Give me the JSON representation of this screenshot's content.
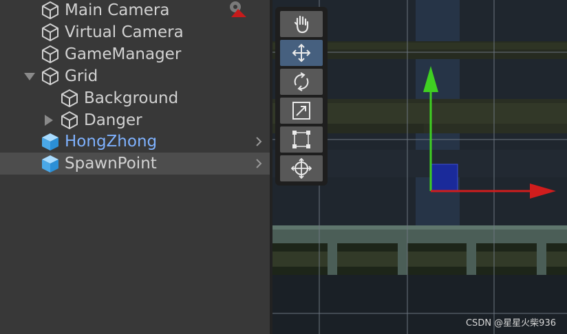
{
  "hierarchy": {
    "items": [
      {
        "label": "Main Camera",
        "icon": "cube-outline-icon"
      },
      {
        "label": "Virtual Camera",
        "icon": "cube-outline-icon"
      },
      {
        "label": "GameManager",
        "icon": "cube-outline-icon"
      },
      {
        "label": "Grid",
        "icon": "cube-outline-icon",
        "foldout": "expanded"
      },
      {
        "label": "Background",
        "icon": "cube-outline-icon"
      },
      {
        "label": "Danger",
        "icon": "cube-outline-icon",
        "foldout": "collapsed"
      },
      {
        "label": "HongZhong",
        "icon": "prefab-cube-icon",
        "color": "#7fb2ff"
      },
      {
        "label": "SpawnPoint",
        "icon": "prefab-cube-icon",
        "selected": true
      }
    ]
  },
  "scene": {
    "tools": [
      {
        "name": "hand-tool",
        "icon": "hand-icon"
      },
      {
        "name": "move-tool",
        "icon": "move-arrows-icon",
        "active": true
      },
      {
        "name": "rotate-tool",
        "icon": "rotate-icon"
      },
      {
        "name": "scale-tool",
        "icon": "scale-icon"
      },
      {
        "name": "rect-tool",
        "icon": "rect-icon"
      },
      {
        "name": "transform-tool",
        "icon": "transform-icon"
      }
    ],
    "gizmo": {
      "y_axis_color": "#3fcf22",
      "x_axis_color": "#d01d1d",
      "plane_color": "#1a2a9a"
    },
    "watermark": "CSDN @星星火柴936"
  }
}
